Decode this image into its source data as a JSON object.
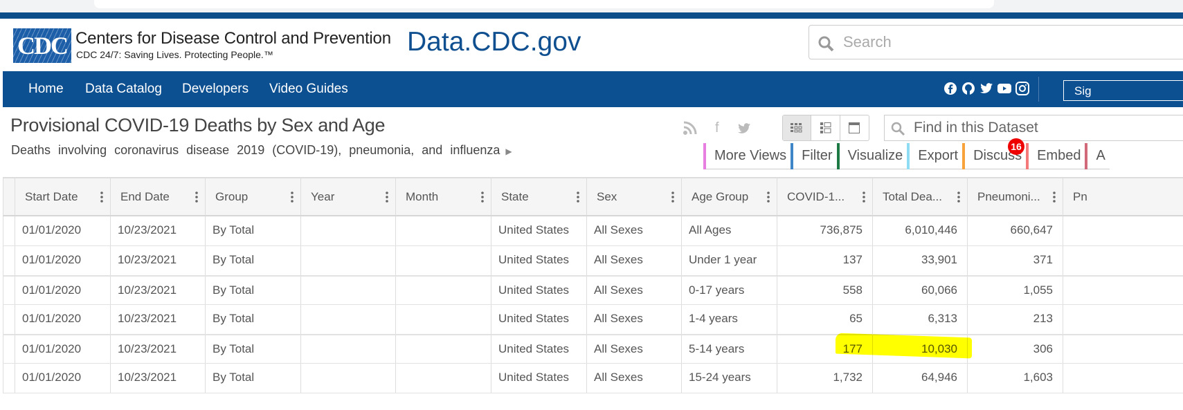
{
  "header": {
    "logo_text": "CDC",
    "org_name": "Centers for Disease Control and Prevention",
    "tagline": "CDC 24/7: Saving Lives. Protecting People.™",
    "site_name": "Data.CDC.gov",
    "search_placeholder": "Search"
  },
  "nav": {
    "items": [
      {
        "label": "Home"
      },
      {
        "label": "Data Catalog"
      },
      {
        "label": "Developers"
      },
      {
        "label": "Video Guides"
      }
    ],
    "social_icons": [
      "facebook-icon",
      "github-icon",
      "twitter-icon",
      "youtube-icon",
      "instagram-icon"
    ],
    "signin_label": "Sig"
  },
  "dataset": {
    "title": "Provisional COVID-19 Deaths by Sex and Age",
    "description": "Deaths involving coronavirus disease 2019 (COVID-19), pneumonia, and influenza",
    "find_placeholder": "Find in this Dataset",
    "actions": [
      {
        "label": "More Views",
        "color": "#e77fe0"
      },
      {
        "label": "Filter",
        "color": "#3f86c6"
      },
      {
        "label": "Visualize",
        "color": "#1e7a45"
      },
      {
        "label": "Export",
        "color": "#8fdcf5"
      },
      {
        "label": "Discuss",
        "color": "#f7a23b"
      },
      {
        "label": "Embed",
        "color": "#f47a7a"
      },
      {
        "label": "A",
        "color": "#d06a7a"
      }
    ],
    "discuss_count": "16"
  },
  "table": {
    "columns": [
      {
        "label": "Start Date",
        "align": "l"
      },
      {
        "label": "End Date",
        "align": "l"
      },
      {
        "label": "Group",
        "align": "l"
      },
      {
        "label": "Year",
        "align": "l"
      },
      {
        "label": "Month",
        "align": "l"
      },
      {
        "label": "State",
        "align": "l"
      },
      {
        "label": "Sex",
        "align": "l"
      },
      {
        "label": "Age Group",
        "align": "l"
      },
      {
        "label": "COVID-1...",
        "align": "r"
      },
      {
        "label": "Total Dea...",
        "align": "r"
      },
      {
        "label": "Pneumoni...",
        "align": "r"
      },
      {
        "label": "Pn",
        "align": "l"
      }
    ],
    "rows": [
      [
        "01/01/2020",
        "10/23/2021",
        "By Total",
        "",
        "",
        "United States",
        "All Sexes",
        "All Ages",
        "736,875",
        "6,010,446",
        "660,647",
        ""
      ],
      [
        "01/01/2020",
        "10/23/2021",
        "By Total",
        "",
        "",
        "United States",
        "All Sexes",
        "Under 1 year",
        "137",
        "33,901",
        "371",
        ""
      ],
      [
        "01/01/2020",
        "10/23/2021",
        "By Total",
        "",
        "",
        "United States",
        "All Sexes",
        "0-17 years",
        "558",
        "60,066",
        "1,055",
        ""
      ],
      [
        "01/01/2020",
        "10/23/2021",
        "By Total",
        "",
        "",
        "United States",
        "All Sexes",
        "1-4 years",
        "65",
        "6,313",
        "213",
        ""
      ],
      [
        "01/01/2020",
        "10/23/2021",
        "By Total",
        "",
        "",
        "United States",
        "All Sexes",
        "5-14 years",
        "177",
        "10,030",
        "306",
        ""
      ],
      [
        "01/01/2020",
        "10/23/2021",
        "By Total",
        "",
        "",
        "United States",
        "All Sexes",
        "15-24 years",
        "1,732",
        "64,946",
        "1,603",
        ""
      ]
    ],
    "highlight_color": "#ffff00"
  }
}
